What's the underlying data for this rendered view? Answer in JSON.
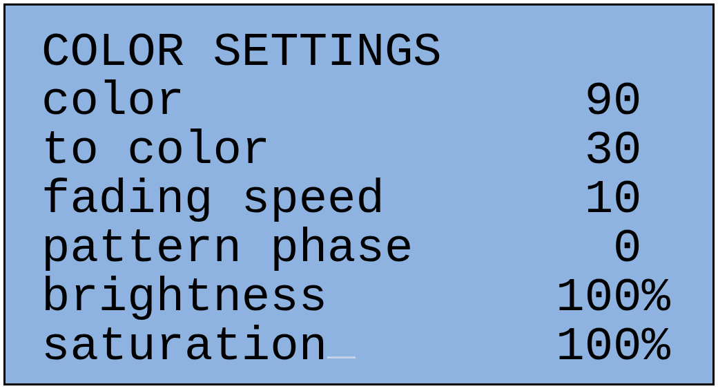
{
  "title": "COLOR SETTINGS",
  "rows": [
    {
      "label": "color",
      "value": "90",
      "cursor": false
    },
    {
      "label": "to color",
      "value": "30",
      "cursor": false
    },
    {
      "label": "fading speed",
      "value": "10",
      "cursor": false
    },
    {
      "label": "pattern phase",
      "value": "0",
      "cursor": false
    },
    {
      "label": "brightness",
      "value": "100",
      "unit": "%",
      "cursor": false
    },
    {
      "label": "saturation",
      "value": "100",
      "unit": "%",
      "cursor": true
    }
  ]
}
